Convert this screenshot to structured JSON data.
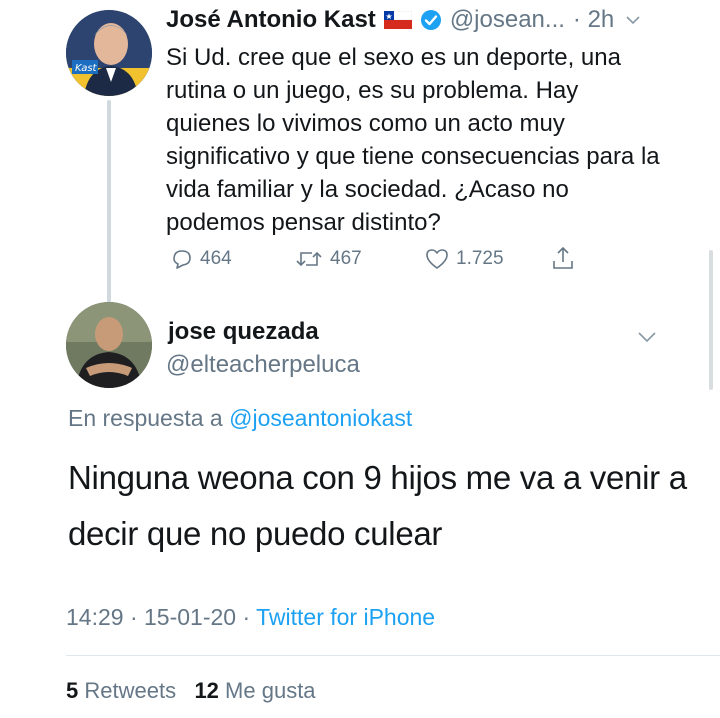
{
  "parent_tweet": {
    "author_name": "José Antonio Kast",
    "handle": "@josean...",
    "time": "· 2h",
    "avatar_caption": "Kast",
    "text": "Si Ud. cree que el sexo es un deporte, una rutina o un juego, es su problema. Hay quienes lo vivimos como un acto muy significativo y que tiene consecuencias para la vida familiar y la sociedad. ¿Acaso no podemos pensar distinto?",
    "replies": "464",
    "retweets": "467",
    "likes": "1.725",
    "flag_icon": "chile-flag-icon",
    "verified_icon": "verified-badge-icon"
  },
  "reply_tweet": {
    "author_name": "jose quezada",
    "handle": "@elteacherpeluca",
    "reply_prefix": "En respuesta a",
    "reply_mention": "@joseantoniokast",
    "text": "Ninguna weona con 9 hijos me va a venir a decir que no puedo culear",
    "time": "14:29",
    "date": "15-01-20",
    "source": "Twitter for iPhone",
    "retweet_count": "5",
    "retweet_label": "Retweets",
    "like_count": "12",
    "like_label": "Me gusta"
  },
  "colors": {
    "text": "#14171a",
    "secondary": "#657786",
    "link": "#1da1f2",
    "thread_line": "#cfd9de"
  }
}
